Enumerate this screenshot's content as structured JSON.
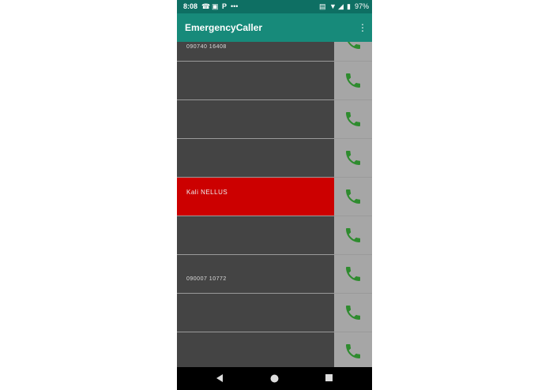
{
  "status_bar": {
    "time": "8:08",
    "battery": "97%",
    "icons": [
      "whatsapp-icon",
      "instagram-icon",
      "pinterest-icon",
      "more-dots-icon",
      "vibrate-icon",
      "wifi-icon",
      "signal-icon",
      "battery-icon"
    ]
  },
  "app_bar": {
    "title": "EmergencyCaller",
    "menu_icon": "overflow-menu-icon"
  },
  "colors": {
    "status_bar": "#0e6f63",
    "app_bar": "#178a7a",
    "row_background": "#444444",
    "row_active": "#cc0000",
    "call_button_background": "#a6a6a6",
    "call_icon": "#2e8b2e"
  },
  "contacts": [
    {
      "name": "",
      "number": "090740 16408",
      "partial": true
    },
    {
      "name": "",
      "number": ""
    },
    {
      "name": "",
      "number": ""
    },
    {
      "name": "",
      "number": ""
    },
    {
      "name": "Kali NELLUS",
      "number": "",
      "active": true
    },
    {
      "name": "",
      "number": ""
    },
    {
      "name": "",
      "number": "090007 10772"
    },
    {
      "name": "",
      "number": ""
    },
    {
      "name": "",
      "number": ""
    }
  ],
  "nav_bar": {
    "back_icon": "back-triangle-icon",
    "home_icon": "home-circle-icon",
    "recents_icon": "recents-square-icon"
  }
}
